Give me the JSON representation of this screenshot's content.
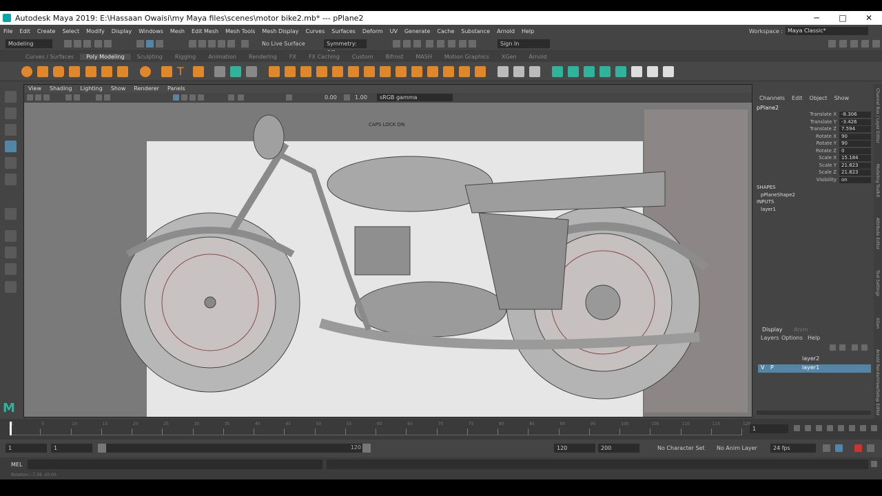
{
  "window": {
    "title": "Autodesk Maya 2019: E:\\Hassaan Owaisi\\my Maya files\\scenes\\motor bike2.mb*  ---  pPlane2"
  },
  "menu": [
    "File",
    "Edit",
    "Create",
    "Select",
    "Modify",
    "Display",
    "Windows",
    "Mesh",
    "Edit Mesh",
    "Mesh Tools",
    "Mesh Display",
    "Curves",
    "Surfaces",
    "Deform",
    "UV",
    "Generate",
    "Cache",
    "Substance",
    "Arnold",
    "Help"
  ],
  "workspace": {
    "label": "Workspace :",
    "value": "Maya Classic*"
  },
  "statusline": {
    "mode": "Modeling",
    "live_surface": "No Live Surface",
    "symmetry": "Symmetry: Off",
    "sign_in": "Sign In"
  },
  "shelf_tabs": [
    "Curves / Surfaces",
    "Poly Modeling",
    "Sculpting",
    "Rigging",
    "Animation",
    "Rendering",
    "FX",
    "FX Caching",
    "Custom",
    "Bifrost",
    "MASH",
    "Motion Graphics",
    "XGen",
    "Arnold"
  ],
  "shelf_active": "Poly Modeling",
  "viewport": {
    "menu": [
      "View",
      "Shading",
      "Lighting",
      "Show",
      "Renderer",
      "Panels"
    ],
    "exposure": "0.00",
    "gamma": "1.00",
    "colorspace": "sRGB gamma",
    "caps_lock": "CAPS LOCK ON"
  },
  "channel_box": {
    "menu": [
      "Channels",
      "Edit",
      "Object",
      "Show"
    ],
    "object": "pPlane2",
    "channels": [
      {
        "label": "Translate X",
        "value": "-8.306"
      },
      {
        "label": "Translate Y",
        "value": "-3.426"
      },
      {
        "label": "Translate Z",
        "value": "7.594"
      },
      {
        "label": "Rotate X",
        "value": "90"
      },
      {
        "label": "Rotate Y",
        "value": "90"
      },
      {
        "label": "Rotate Z",
        "value": "0"
      },
      {
        "label": "Scale X",
        "value": "15.184"
      },
      {
        "label": "Scale Y",
        "value": "21.823"
      },
      {
        "label": "Scale Z",
        "value": "21.823"
      },
      {
        "label": "Visibility",
        "value": "on"
      }
    ],
    "shapes_header": "SHAPES",
    "shape": "pPlaneShape2",
    "inputs_header": "INPUTS",
    "input": "layer1"
  },
  "layer_editor": {
    "tabs": [
      "Display",
      "Anim"
    ],
    "menu": [
      "Layers",
      "Options",
      "Help"
    ],
    "layers": [
      {
        "name": "layer2",
        "selected": false
      },
      {
        "name": "layer1",
        "selected": true
      }
    ]
  },
  "timeline": {
    "ticks": [
      "1",
      "5",
      "10",
      "15",
      "20",
      "25",
      "30",
      "35",
      "40",
      "45",
      "50",
      "55",
      "60",
      "65",
      "70",
      "75",
      "80",
      "85",
      "90",
      "95",
      "100",
      "105",
      "110",
      "115",
      "120"
    ],
    "current": "1"
  },
  "range": {
    "start": "1",
    "min": "1",
    "slider_end": "120",
    "end": "120",
    "max": "200",
    "char_set": "No Character Set",
    "anim_layer": "No Anim Layer",
    "fps": "24 fps"
  },
  "cmdline": {
    "label": "MEL"
  },
  "helpline": {
    "text": "Rotation:  -7.38      -10.00"
  },
  "side_tabs": [
    "Channel Box / Layer Editor",
    "Modeling Toolkit",
    "Attribute Editor",
    "Tool Settings",
    "XGen",
    "Arnold RenderView/Setup Editor"
  ],
  "colors": {
    "accent": "#5285a6",
    "shelf_orange": "#e0872a",
    "shelf_green": "#2fb39a"
  }
}
